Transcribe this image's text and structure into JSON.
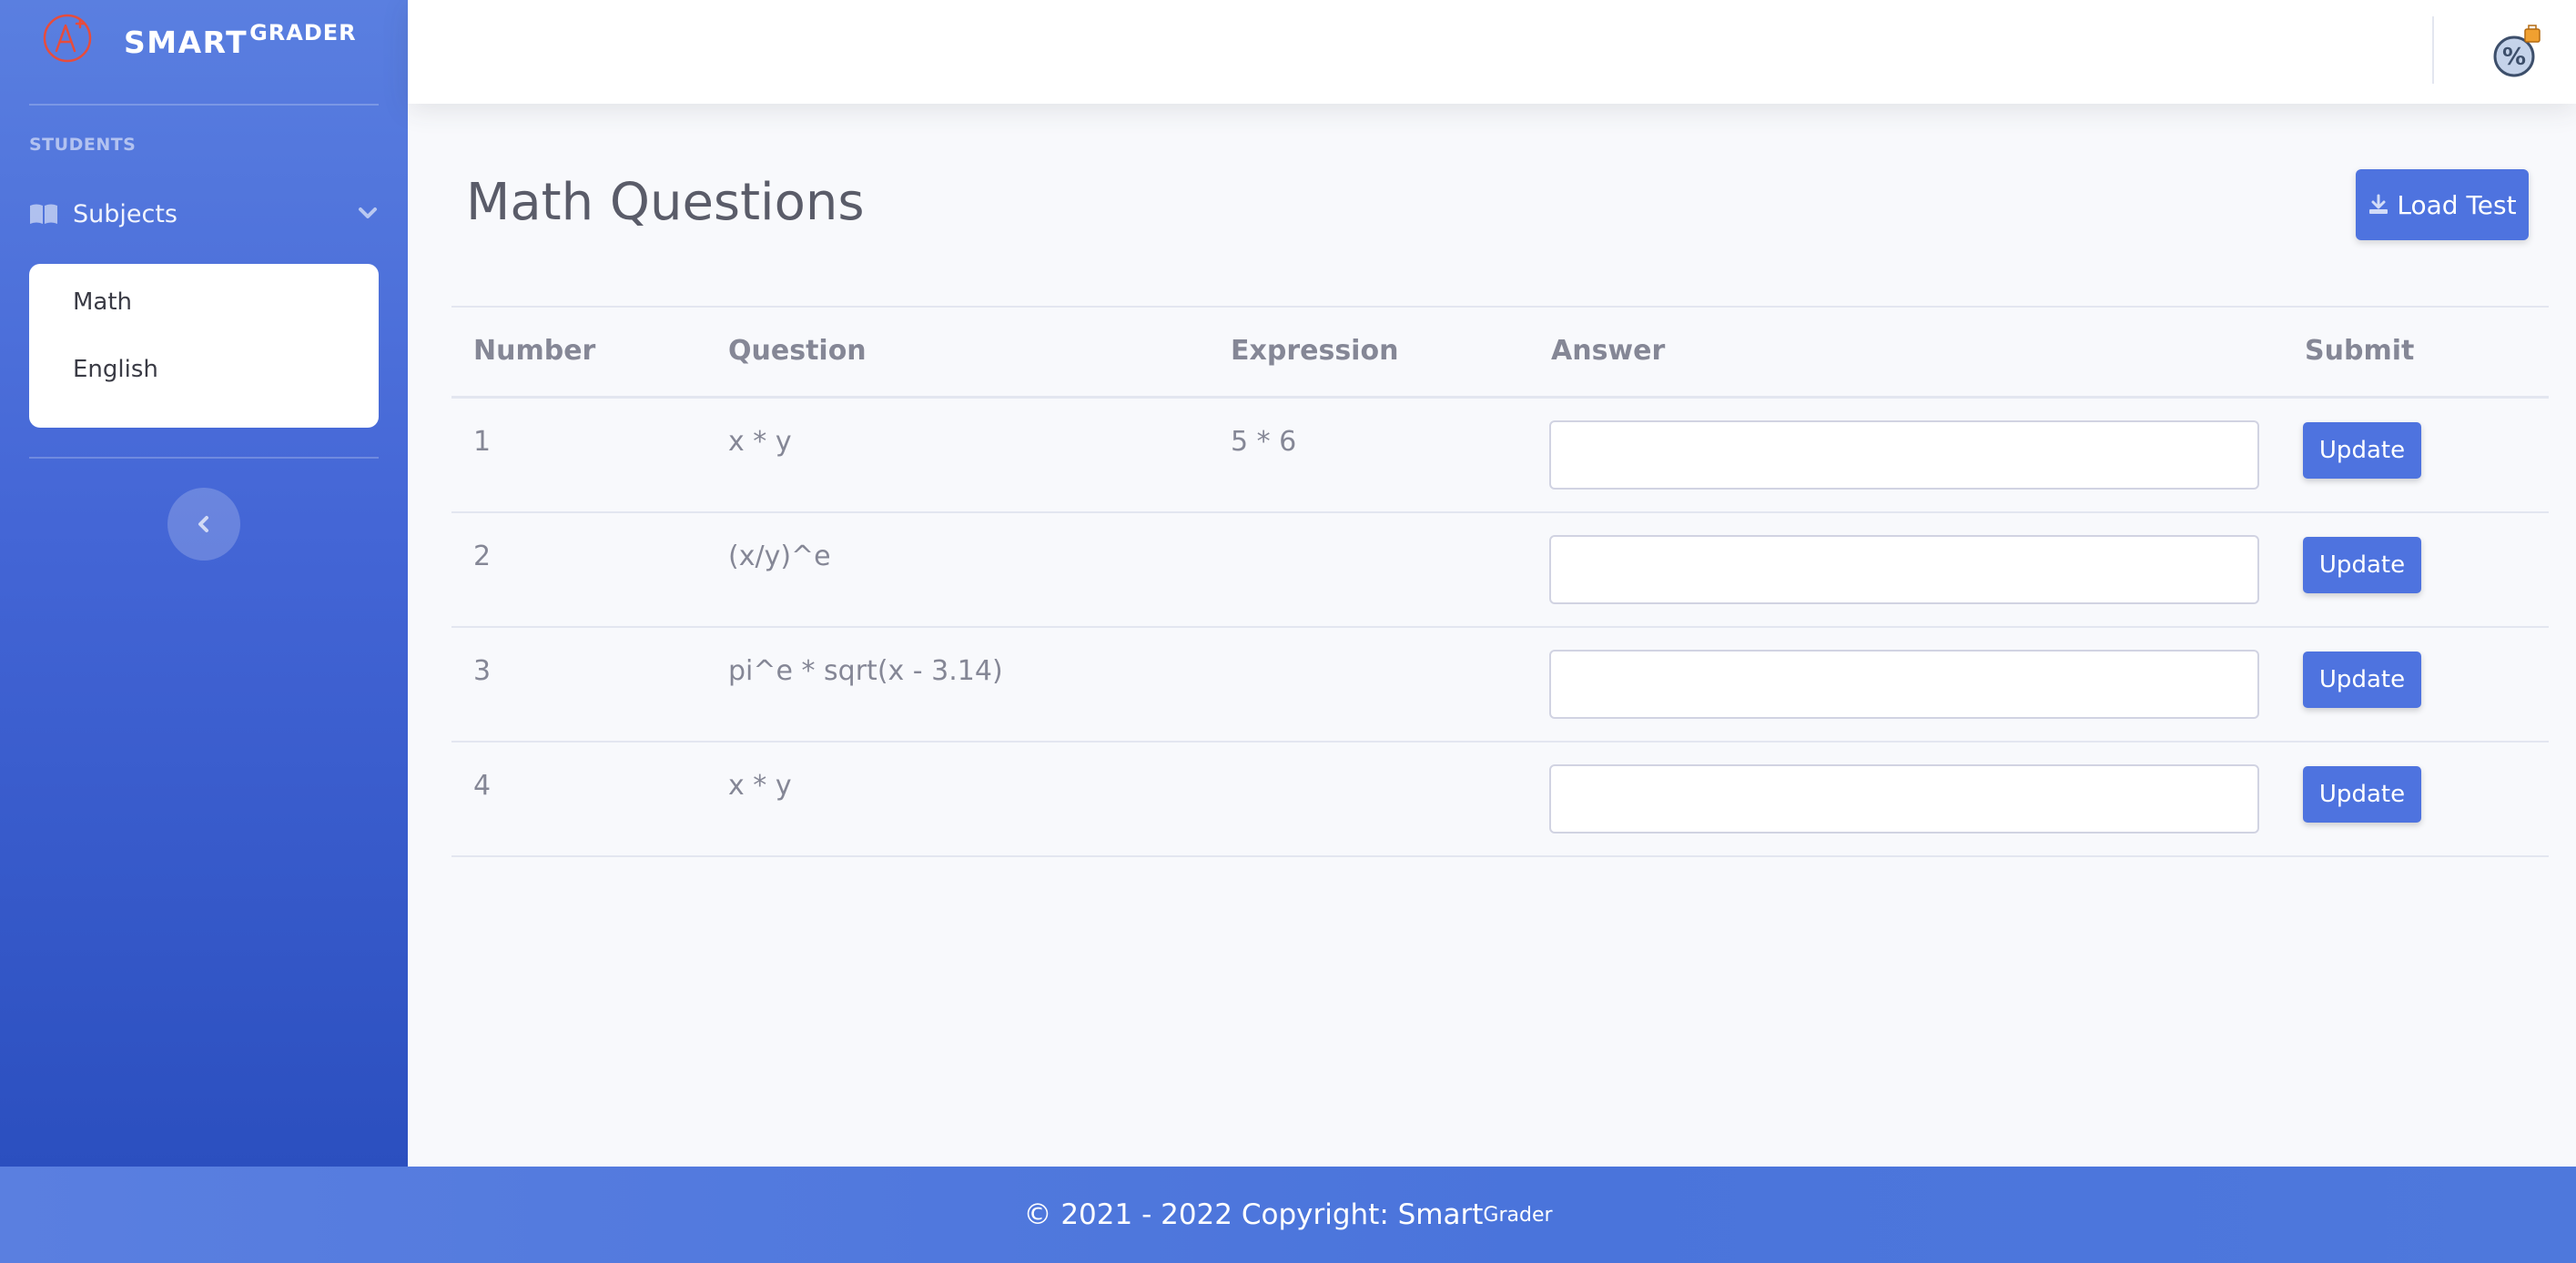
{
  "brand": {
    "name_main": "SMART",
    "name_sup": "GRADER",
    "logo_icon": "grade-a-plus-icon",
    "logo_color": "#e74c3c"
  },
  "sidebar": {
    "section_heading": "STUDENTS",
    "nav_item": {
      "label": "Subjects",
      "icon": "book-open-icon"
    },
    "submenu": [
      {
        "label": "Math"
      },
      {
        "label": "English"
      }
    ],
    "toggle_icon": "chevron-left-icon"
  },
  "topbar": {
    "user_icon": "user-avatar-icon"
  },
  "page": {
    "title": "Math Questions",
    "load_button": "Load Test"
  },
  "table": {
    "columns": [
      "Number",
      "Question",
      "Expression",
      "Answer",
      "Submit"
    ],
    "rows": [
      {
        "number": "1",
        "question": "x * y",
        "expression": "5 * 6",
        "answer": "",
        "button": "Update"
      },
      {
        "number": "2",
        "question": "(x/y)^e",
        "expression": "",
        "answer": "",
        "button": "Update"
      },
      {
        "number": "3",
        "question": "pi^e * sqrt(x - 3.14)",
        "expression": "",
        "answer": "",
        "button": "Update"
      },
      {
        "number": "4",
        "question": "x * y",
        "expression": "",
        "answer": "",
        "button": "Update"
      }
    ]
  },
  "footer": {
    "text": "© 2021 - 2022 Copyright: Smart",
    "sup": "Grader"
  },
  "colors": {
    "primary": "#4e73df",
    "text_muted": "#858796",
    "title": "#5a5c69"
  }
}
